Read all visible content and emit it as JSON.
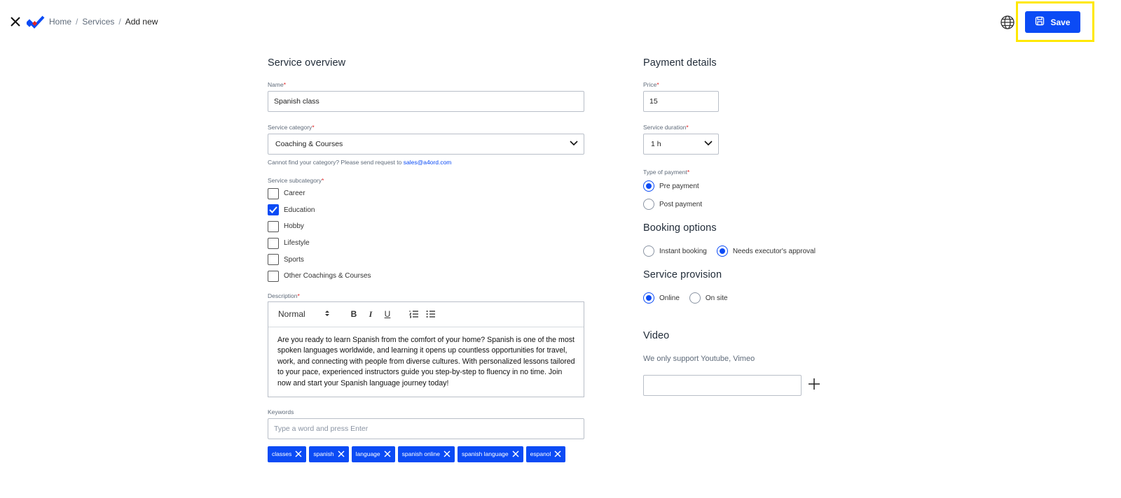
{
  "breadcrumb": {
    "home": "Home",
    "sep1": "/",
    "services": "Services",
    "sep2": "/",
    "current": "Add new"
  },
  "header": {
    "save_label": "Save"
  },
  "colors": {
    "accent": "#0b4bf5",
    "highlight": "#ffe800"
  },
  "overview": {
    "title": "Service overview",
    "name_label": "Name",
    "name_value": "Spanish class",
    "category_label": "Service category",
    "category_value": "Coaching & Courses",
    "category_hint": "Cannot find your category? Please send request to",
    "category_hint_email": "sales@a4ord.com",
    "subcategory_label": "Service subcategory",
    "subcategories": [
      {
        "label": "Career",
        "checked": false
      },
      {
        "label": "Education",
        "checked": true
      },
      {
        "label": "Hobby",
        "checked": false
      },
      {
        "label": "Lifestyle",
        "checked": false
      },
      {
        "label": "Sports",
        "checked": false
      },
      {
        "label": "Other Coachings & Courses",
        "checked": false
      }
    ],
    "description_label": "Description",
    "editor_style": "Normal",
    "description_text": "Are you ready to learn Spanish from the comfort of your home? Spanish is one of the most spoken languages worldwide, and learning it opens up countless opportunities for travel, work, and connecting with people from diverse cultures. With personalized lessons tailored to your pace, experienced instructors guide you step-by-step to fluency in no time. Join now and start your Spanish language journey today!",
    "keywords_label": "Keywords",
    "keywords_placeholder": "Type a word and press Enter",
    "keywords": [
      "classes",
      "spanish",
      "language",
      "spanish online",
      "spanish language",
      "espanol"
    ]
  },
  "payment": {
    "title": "Payment details",
    "price_label": "Price",
    "price_value": "15",
    "duration_label": "Service duration",
    "duration_value": "1 h",
    "type_label": "Type of payment",
    "pre_payment": "Pre payment",
    "post_payment": "Post payment",
    "selected_type": "Pre payment"
  },
  "booking": {
    "title": "Booking options",
    "instant": "Instant booking",
    "approval": "Needs executor's approval",
    "selected": "Needs executor's approval"
  },
  "provision": {
    "title": "Service provision",
    "online": "Online",
    "onsite": "On site",
    "selected": "Online"
  },
  "video": {
    "title": "Video",
    "hint": "We only support Youtube, Vimeo",
    "value": ""
  }
}
